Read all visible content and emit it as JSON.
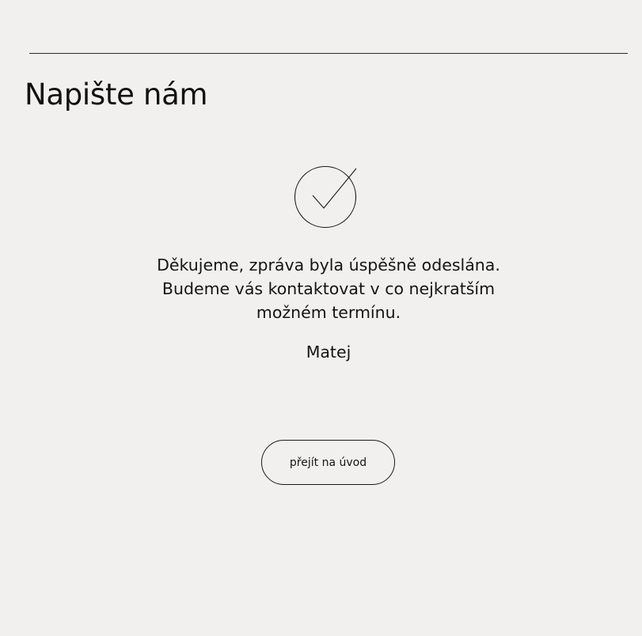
{
  "page": {
    "title": "Napište nám"
  },
  "confirmation": {
    "icon": "checkmark-circle-icon",
    "message_lines": [
      "Děkujeme, zpráva byla úspěšně odeslána.",
      "Budeme vás kontaktovat v co nejkratším",
      "možném termínu."
    ],
    "signature": "Matej"
  },
  "actions": {
    "home_label": "přejít na úvod"
  },
  "colors": {
    "background": "#f1f0ee",
    "text": "#141414",
    "stroke": "#1a1a1a"
  }
}
